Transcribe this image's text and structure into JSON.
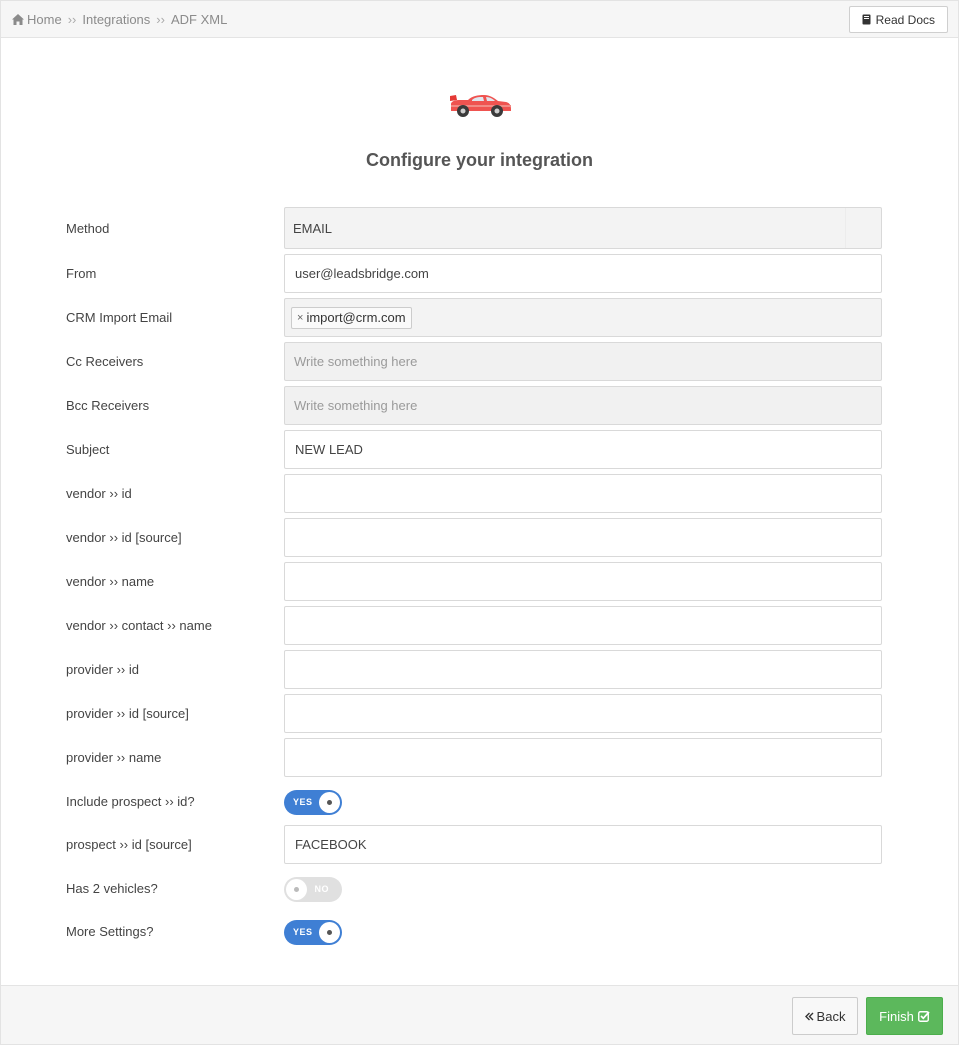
{
  "breadcrumb": {
    "home": "Home",
    "integrations": "Integrations",
    "current": "ADF XML",
    "separator": "››"
  },
  "header": {
    "read_docs": "Read Docs",
    "title": "Configure your integration"
  },
  "form": {
    "method": {
      "label": "Method",
      "value": "EMAIL"
    },
    "from": {
      "label": "From",
      "value": "user@leadsbridge.com"
    },
    "crm_import_email": {
      "label": "CRM Import Email",
      "tag": "import@crm.com",
      "tag_remove": "×"
    },
    "cc_receivers": {
      "label": "Cc Receivers",
      "placeholder": "Write something here"
    },
    "bcc_receivers": {
      "label": "Bcc Receivers",
      "placeholder": "Write something here"
    },
    "subject": {
      "label": "Subject",
      "value": "NEW LEAD"
    },
    "vendor_id": {
      "label": "vendor ›› id",
      "value": ""
    },
    "vendor_id_source": {
      "label": "vendor ›› id [source]",
      "value": ""
    },
    "vendor_name": {
      "label": "vendor ›› name",
      "value": ""
    },
    "vendor_contact_name": {
      "label": "vendor ›› contact ›› name",
      "value": ""
    },
    "provider_id": {
      "label": "provider ›› id",
      "value": ""
    },
    "provider_id_source": {
      "label": "provider ›› id [source]",
      "value": ""
    },
    "provider_name": {
      "label": "provider ›› name",
      "value": ""
    },
    "include_prospect_id": {
      "label": "Include prospect ›› id?",
      "state": "YES",
      "on": true
    },
    "prospect_id_source": {
      "label": "prospect ›› id [source]",
      "value": "FACEBOOK"
    },
    "has_2_vehicles": {
      "label": "Has 2 vehicles?",
      "state": "NO",
      "on": false
    },
    "more_settings": {
      "label": "More Settings?",
      "state": "YES",
      "on": true
    }
  },
  "footer": {
    "back": "Back",
    "finish": "Finish"
  },
  "colors": {
    "toggle_on": "#3f7fd4",
    "finish": "#5cb85c",
    "car": "#ef5350"
  },
  "icons": [
    "home-icon",
    "book-icon",
    "car-icon",
    "double-chevron-left-icon",
    "check-square-icon"
  ]
}
